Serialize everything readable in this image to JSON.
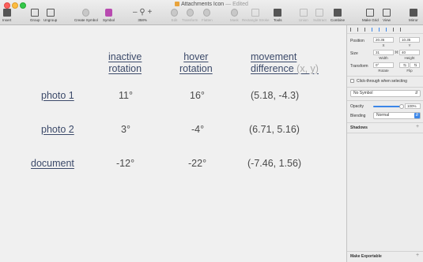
{
  "window": {
    "title": "Attachments Icon",
    "status": "— Edited"
  },
  "toolbar": {
    "insert": "Insert",
    "group": "Group",
    "ungroup": "Ungroup",
    "create_symbol": "Create Symbol",
    "symbol": "Symbol",
    "zoom_minus": "–",
    "zoom_plus": "+",
    "zoom_value": "358%",
    "edit": "Edit",
    "transform": "Transform",
    "flatten": "Flatten",
    "mask": "Mask",
    "scale": "Scale",
    "rectangle_stroke": "Rectangle Stroke",
    "tools": "Tools",
    "union": "Union",
    "subtract": "Subtract",
    "combine": "Combine",
    "make_grid": "Make Grid",
    "view": "View",
    "mirror": "Mirror"
  },
  "table": {
    "headers": [
      {
        "line1": "inactive",
        "line2": "rotation",
        "extra": ""
      },
      {
        "line1": "hover",
        "line2": "rotation",
        "extra": ""
      },
      {
        "line1": "movement",
        "line2": "difference",
        "extra": "(x, y)"
      }
    ],
    "rows": [
      {
        "label": "photo 1",
        "inactive": "11°",
        "hover": "16°",
        "diff": "(5.18, -4.3)"
      },
      {
        "label": "photo 2",
        "inactive": "3°",
        "hover": "-4°",
        "diff": "(6.71, 5.16)"
      },
      {
        "label": "document",
        "inactive": "-12°",
        "hover": "-22°",
        "diff": "(-7.46, 1.56)"
      }
    ]
  },
  "inspector": {
    "position_label": "Position",
    "x_value": "20.36",
    "y_value": "10.35",
    "x_label": "X",
    "y_label": "Y",
    "size_label": "Size",
    "width_value": "31",
    "height_value": "40",
    "width_label": "Width",
    "height_label": "Height",
    "transform_label": "Transform",
    "rotate_value": "0°",
    "rotate_label": "Rotate",
    "flip_label": "Flip",
    "click_through": "Click-through when selecting",
    "symbol_select": "No Symbol",
    "opacity_label": "Opacity",
    "opacity_value": "100%",
    "opacity_level": 1.0,
    "blending_label": "Blending",
    "blending_value": "Normal",
    "shadows_label": "Shadows",
    "make_exportable": "Make Exportable"
  }
}
